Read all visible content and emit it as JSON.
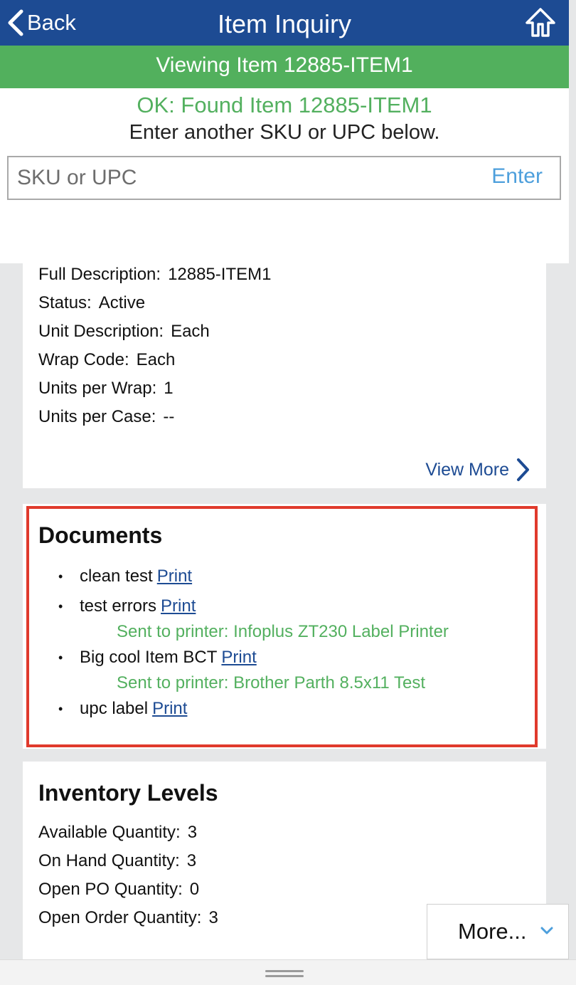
{
  "header": {
    "back_label": "Back",
    "title": "Item Inquiry",
    "status": "Viewing Item 12885-ITEM1"
  },
  "lookup": {
    "ok_message": "OK: Found Item 12885-ITEM1",
    "prompt": "Enter another SKU or UPC below.",
    "placeholder": "SKU or UPC",
    "value": "",
    "enter_label": "Enter"
  },
  "details": {
    "rows": [
      {
        "label": "Full Description:",
        "value": "12885-ITEM1"
      },
      {
        "label": "Status:",
        "value": "Active"
      },
      {
        "label": "Unit Description:",
        "value": "Each"
      },
      {
        "label": "Wrap Code:",
        "value": "Each"
      },
      {
        "label": "Units per Wrap:",
        "value": "1"
      },
      {
        "label": "Units per Case:",
        "value": "--"
      }
    ],
    "view_more_label": "View More"
  },
  "documents": {
    "title": "Documents",
    "print_label": "Print",
    "items": [
      {
        "name": "clean test",
        "sent": ""
      },
      {
        "name": "test errors",
        "sent": "Sent to printer: Infoplus ZT230 Label Printer"
      },
      {
        "name": "Big cool Item BCT",
        "sent": "Sent to printer: Brother Parth 8.5x11 Test"
      },
      {
        "name": "upc label",
        "sent": ""
      }
    ]
  },
  "inventory": {
    "title": "Inventory Levels",
    "rows": [
      {
        "label": "Available Quantity:",
        "value": "3"
      },
      {
        "label": "On Hand Quantity:",
        "value": "3"
      },
      {
        "label": "Open PO Quantity:",
        "value": "0"
      },
      {
        "label": "Open Order Quantity:",
        "value": "3"
      }
    ]
  },
  "more_menu": {
    "label": "More..."
  },
  "colors": {
    "header_blue": "#1d4b93",
    "status_green": "#52b05d",
    "ok_green": "#53b05f",
    "highlight_red": "#e03a2c",
    "link_blue": "#1d4b93",
    "enter_blue": "#4d9fdc"
  },
  "icons": {
    "back": "chevron-left-icon",
    "home": "home-arrow-icon",
    "view_more": "chevron-right-icon",
    "more": "chevron-down-icon",
    "bottom": "drag-handle-icon"
  }
}
